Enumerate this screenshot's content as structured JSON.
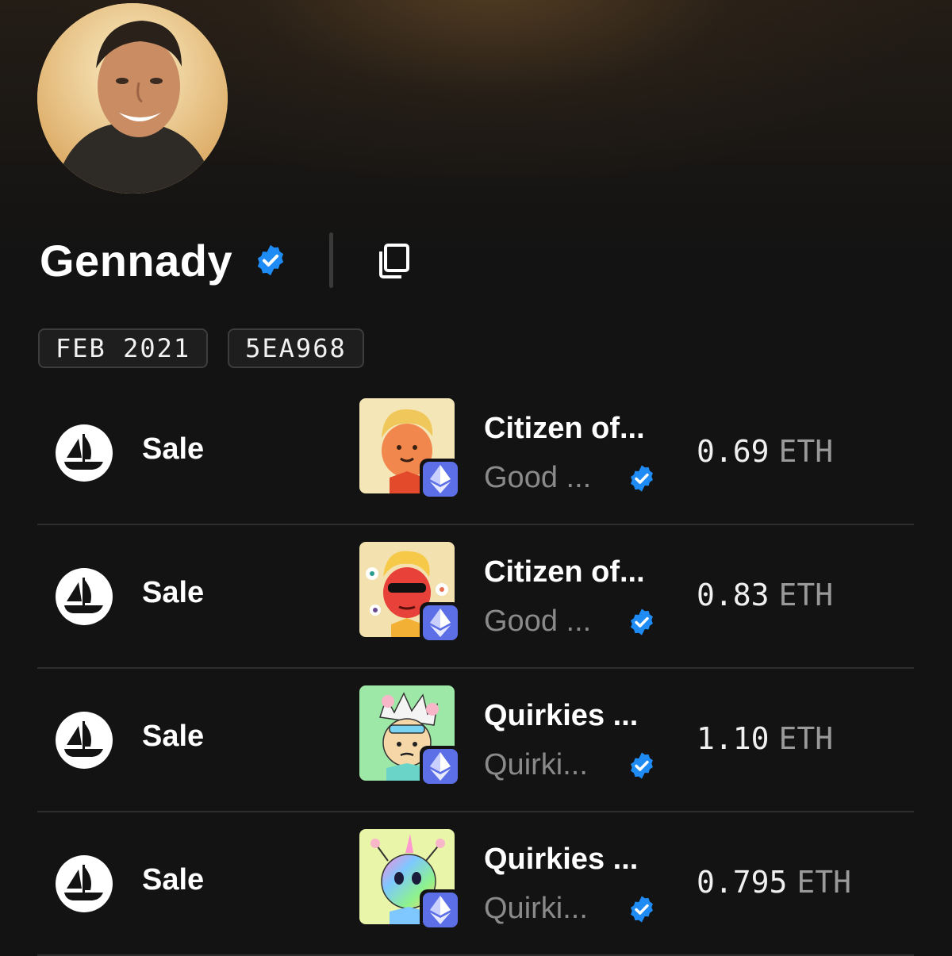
{
  "profile": {
    "name": "Gennady",
    "avatar_icon": "profile-photo",
    "verified_icon": "verified-badge-icon",
    "copy_icon": "copy-icon",
    "joined": "FEB 2021",
    "address": "5EA968"
  },
  "colors": {
    "background": "#131313",
    "verified_blue": "#1f8bf5",
    "eth_badge": "#5c6fe6",
    "secondary_text": "#8a8a8a"
  },
  "activity": [
    {
      "marketplace_icon": "opensea-icon",
      "event": "Sale",
      "title": "Citizen of...",
      "collection": "Good ...",
      "chain_icon": "ethereum-icon",
      "price": "0.69",
      "unit": "ETH"
    },
    {
      "marketplace_icon": "opensea-icon",
      "event": "Sale",
      "title": "Citizen of...",
      "collection": "Good ...",
      "chain_icon": "ethereum-icon",
      "price": "0.83",
      "unit": "ETH"
    },
    {
      "marketplace_icon": "opensea-icon",
      "event": "Sale",
      "title": "Quirkies ...",
      "collection": "Quirki...",
      "chain_icon": "ethereum-icon",
      "price": "1.10",
      "unit": "ETH"
    },
    {
      "marketplace_icon": "opensea-icon",
      "event": "Sale",
      "title": "Quirkies ...",
      "collection": "Quirki...",
      "chain_icon": "ethereum-icon",
      "price": "0.795",
      "unit": "ETH"
    }
  ]
}
